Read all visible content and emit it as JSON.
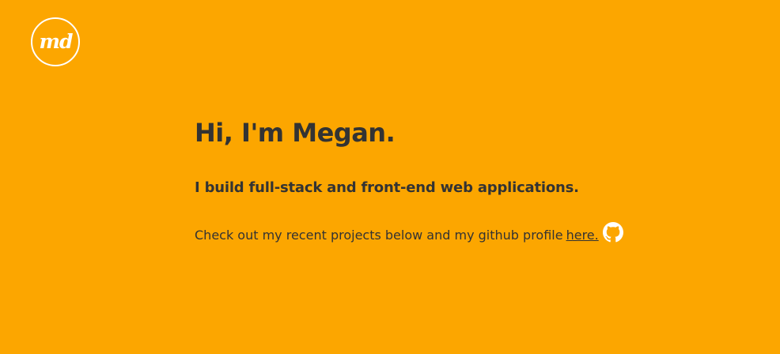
{
  "logo": {
    "text": "md"
  },
  "hero": {
    "headline": "Hi, I'm Megan.",
    "subheadline": "I build full-stack and front-end web applications.",
    "cta_text": "Check out my recent projects below and my github profile",
    "cta_link": "here."
  },
  "icons": {
    "github": "github-icon"
  },
  "colors": {
    "background": "#FCA600",
    "text": "#333333",
    "logo": "#FFFFFF"
  }
}
